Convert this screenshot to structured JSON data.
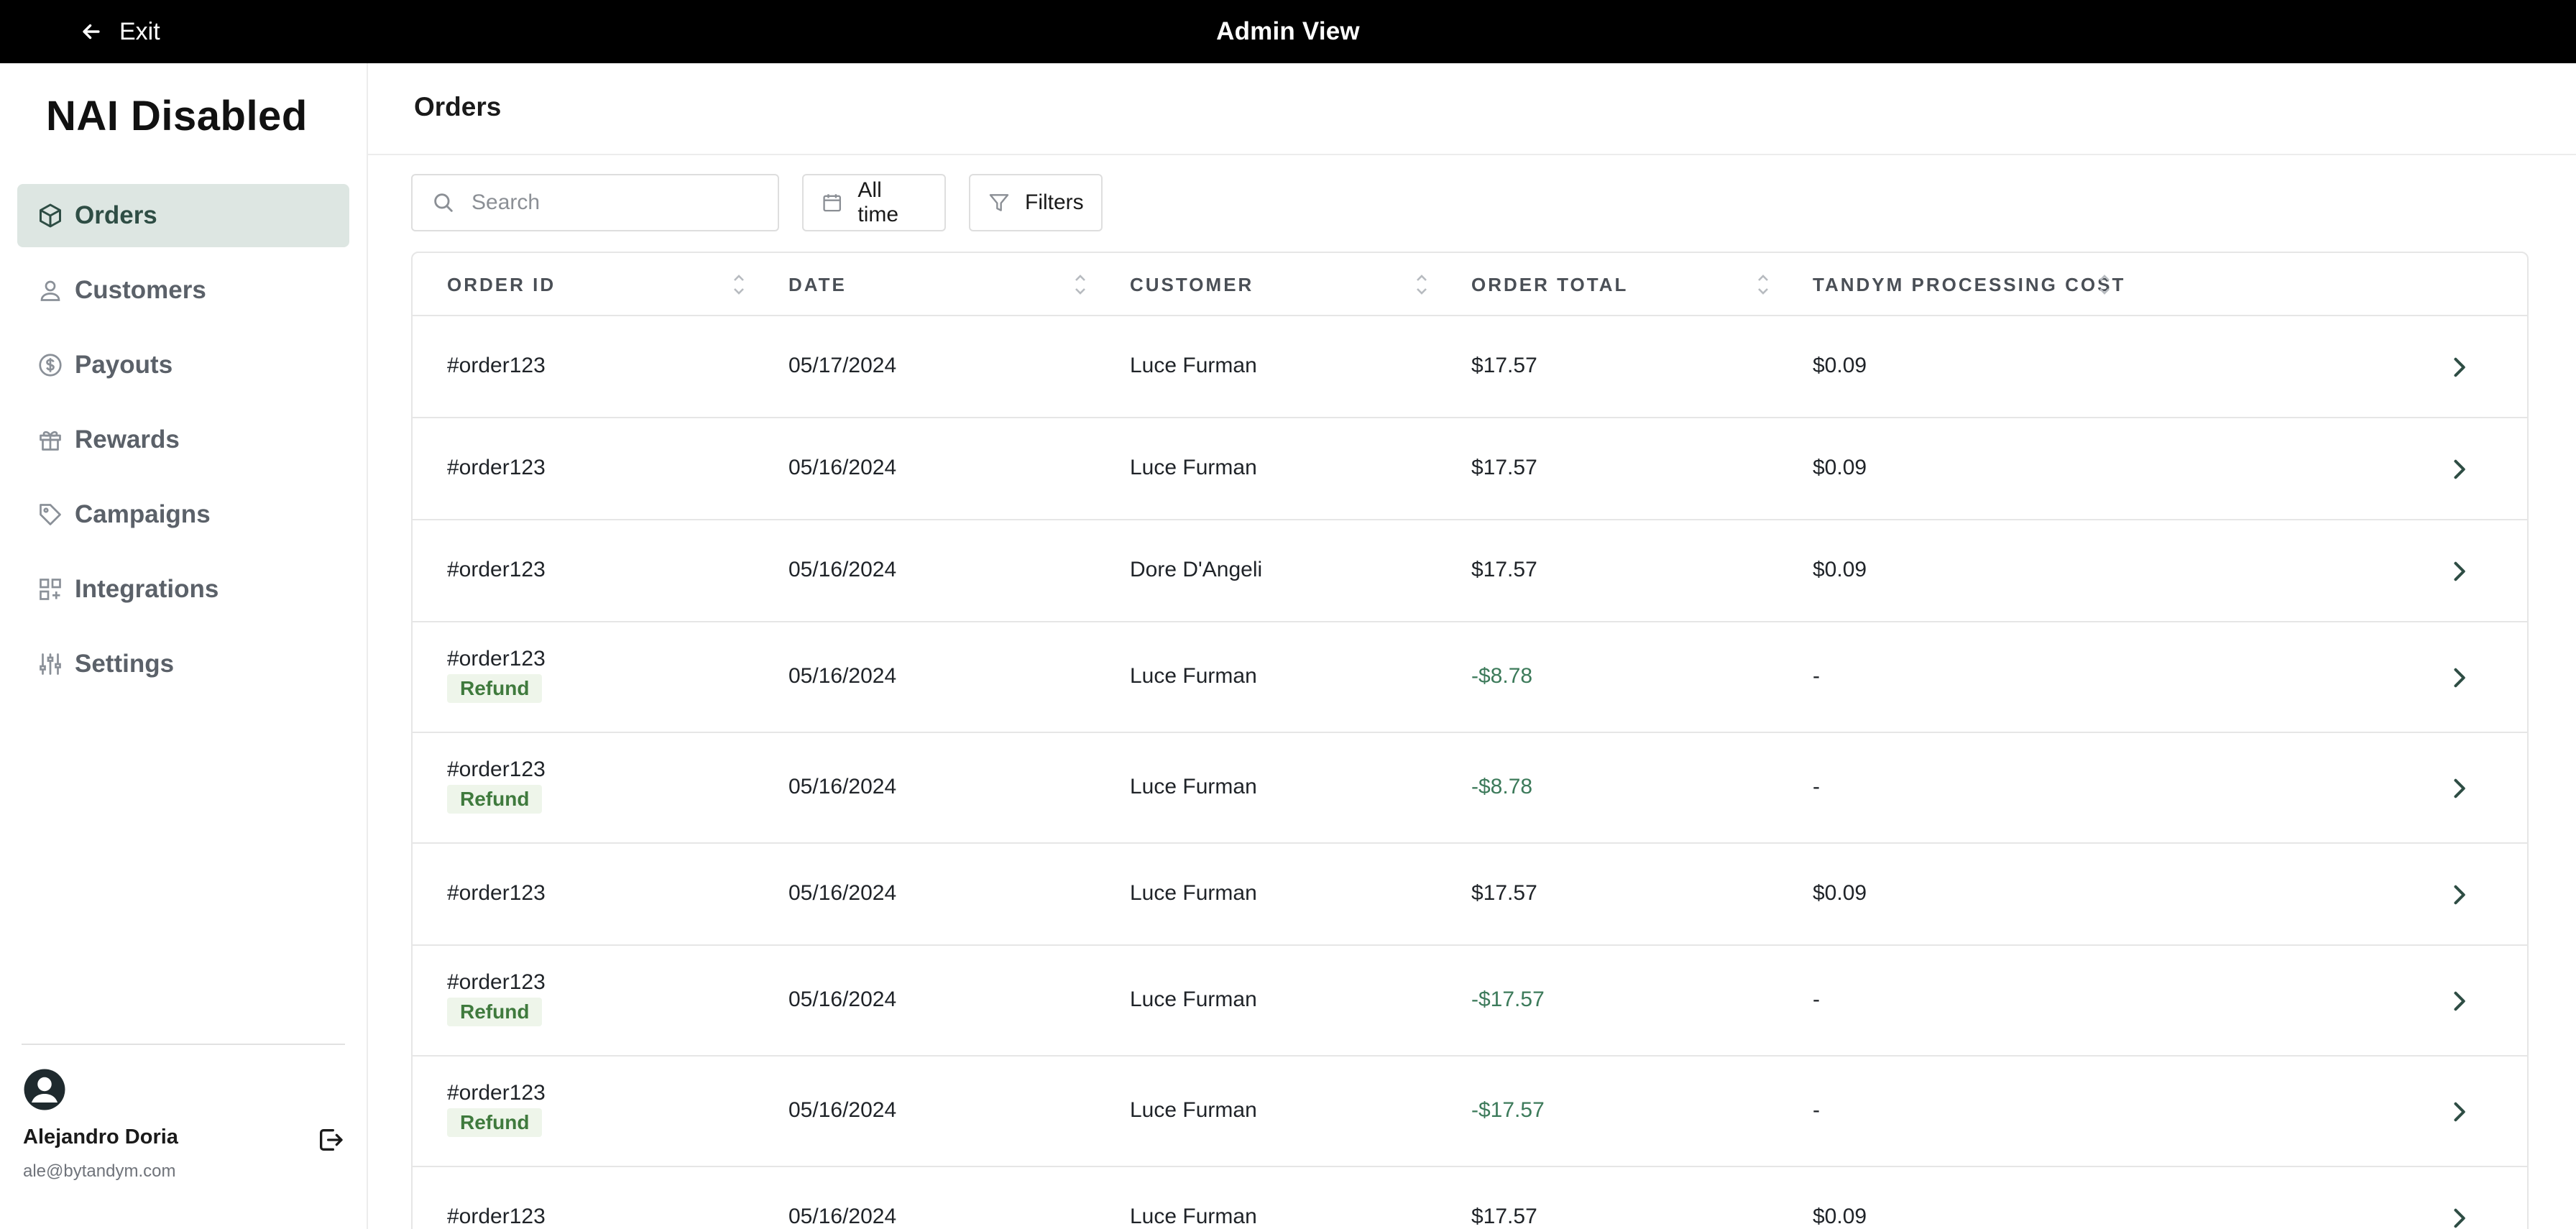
{
  "topbar": {
    "exit_label": "Exit",
    "title": "Admin View"
  },
  "sidebar": {
    "brand": "NAI Disabled",
    "items": [
      {
        "label": "Orders",
        "icon": "box-icon",
        "active": true
      },
      {
        "label": "Customers",
        "icon": "users-icon",
        "active": false
      },
      {
        "label": "Payouts",
        "icon": "dollar-circle-icon",
        "active": false
      },
      {
        "label": "Rewards",
        "icon": "gift-icon",
        "active": false
      },
      {
        "label": "Campaigns",
        "icon": "tag-icon",
        "active": false
      },
      {
        "label": "Integrations",
        "icon": "grid-plus-icon",
        "active": false
      },
      {
        "label": "Settings",
        "icon": "sliders-icon",
        "active": false
      }
    ],
    "user": {
      "name": "Alejandro Doria",
      "email": "ale@bytandym.com"
    }
  },
  "main": {
    "title": "Orders",
    "search": {
      "placeholder": "Search",
      "value": ""
    },
    "date_filter": "All time",
    "filters_label": "Filters"
  },
  "table": {
    "columns": [
      "ORDER ID",
      "DATE",
      "CUSTOMER",
      "ORDER TOTAL",
      "TANDYM PROCESSING COST"
    ],
    "rows": [
      {
        "order_id": "#order123",
        "refund": "",
        "date": "05/17/2024",
        "customer": "Luce Furman",
        "total": "$17.57",
        "cost": "$0.09",
        "negative": false
      },
      {
        "order_id": "#order123",
        "refund": "",
        "date": "05/16/2024",
        "customer": "Luce Furman",
        "total": "$17.57",
        "cost": "$0.09",
        "negative": false
      },
      {
        "order_id": "#order123",
        "refund": "",
        "date": "05/16/2024",
        "customer": "Dore D'Angeli",
        "total": "$17.57",
        "cost": "$0.09",
        "negative": false
      },
      {
        "order_id": "#order123",
        "refund": "Refund",
        "date": "05/16/2024",
        "customer": "Luce Furman",
        "total": "-$8.78",
        "cost": "-",
        "negative": true
      },
      {
        "order_id": "#order123",
        "refund": "Refund",
        "date": "05/16/2024",
        "customer": "Luce Furman",
        "total": "-$8.78",
        "cost": "-",
        "negative": true
      },
      {
        "order_id": "#order123",
        "refund": "",
        "date": "05/16/2024",
        "customer": "Luce Furman",
        "total": "$17.57",
        "cost": "$0.09",
        "negative": false
      },
      {
        "order_id": "#order123",
        "refund": "Refund",
        "date": "05/16/2024",
        "customer": "Luce Furman",
        "total": "-$17.57",
        "cost": "-",
        "negative": true
      },
      {
        "order_id": "#order123",
        "refund": "Refund",
        "date": "05/16/2024",
        "customer": "Luce Furman",
        "total": "-$17.57",
        "cost": "-",
        "negative": true
      },
      {
        "order_id": "#order123",
        "refund": "",
        "date": "05/16/2024",
        "customer": "Luce Furman",
        "total": "$17.57",
        "cost": "$0.09",
        "negative": false
      }
    ]
  },
  "colors": {
    "active_nav_bg": "#dde6e2",
    "negative_amount": "#3c7a5a",
    "refund_badge": "#3f7a3d",
    "topbar": "#000000"
  }
}
